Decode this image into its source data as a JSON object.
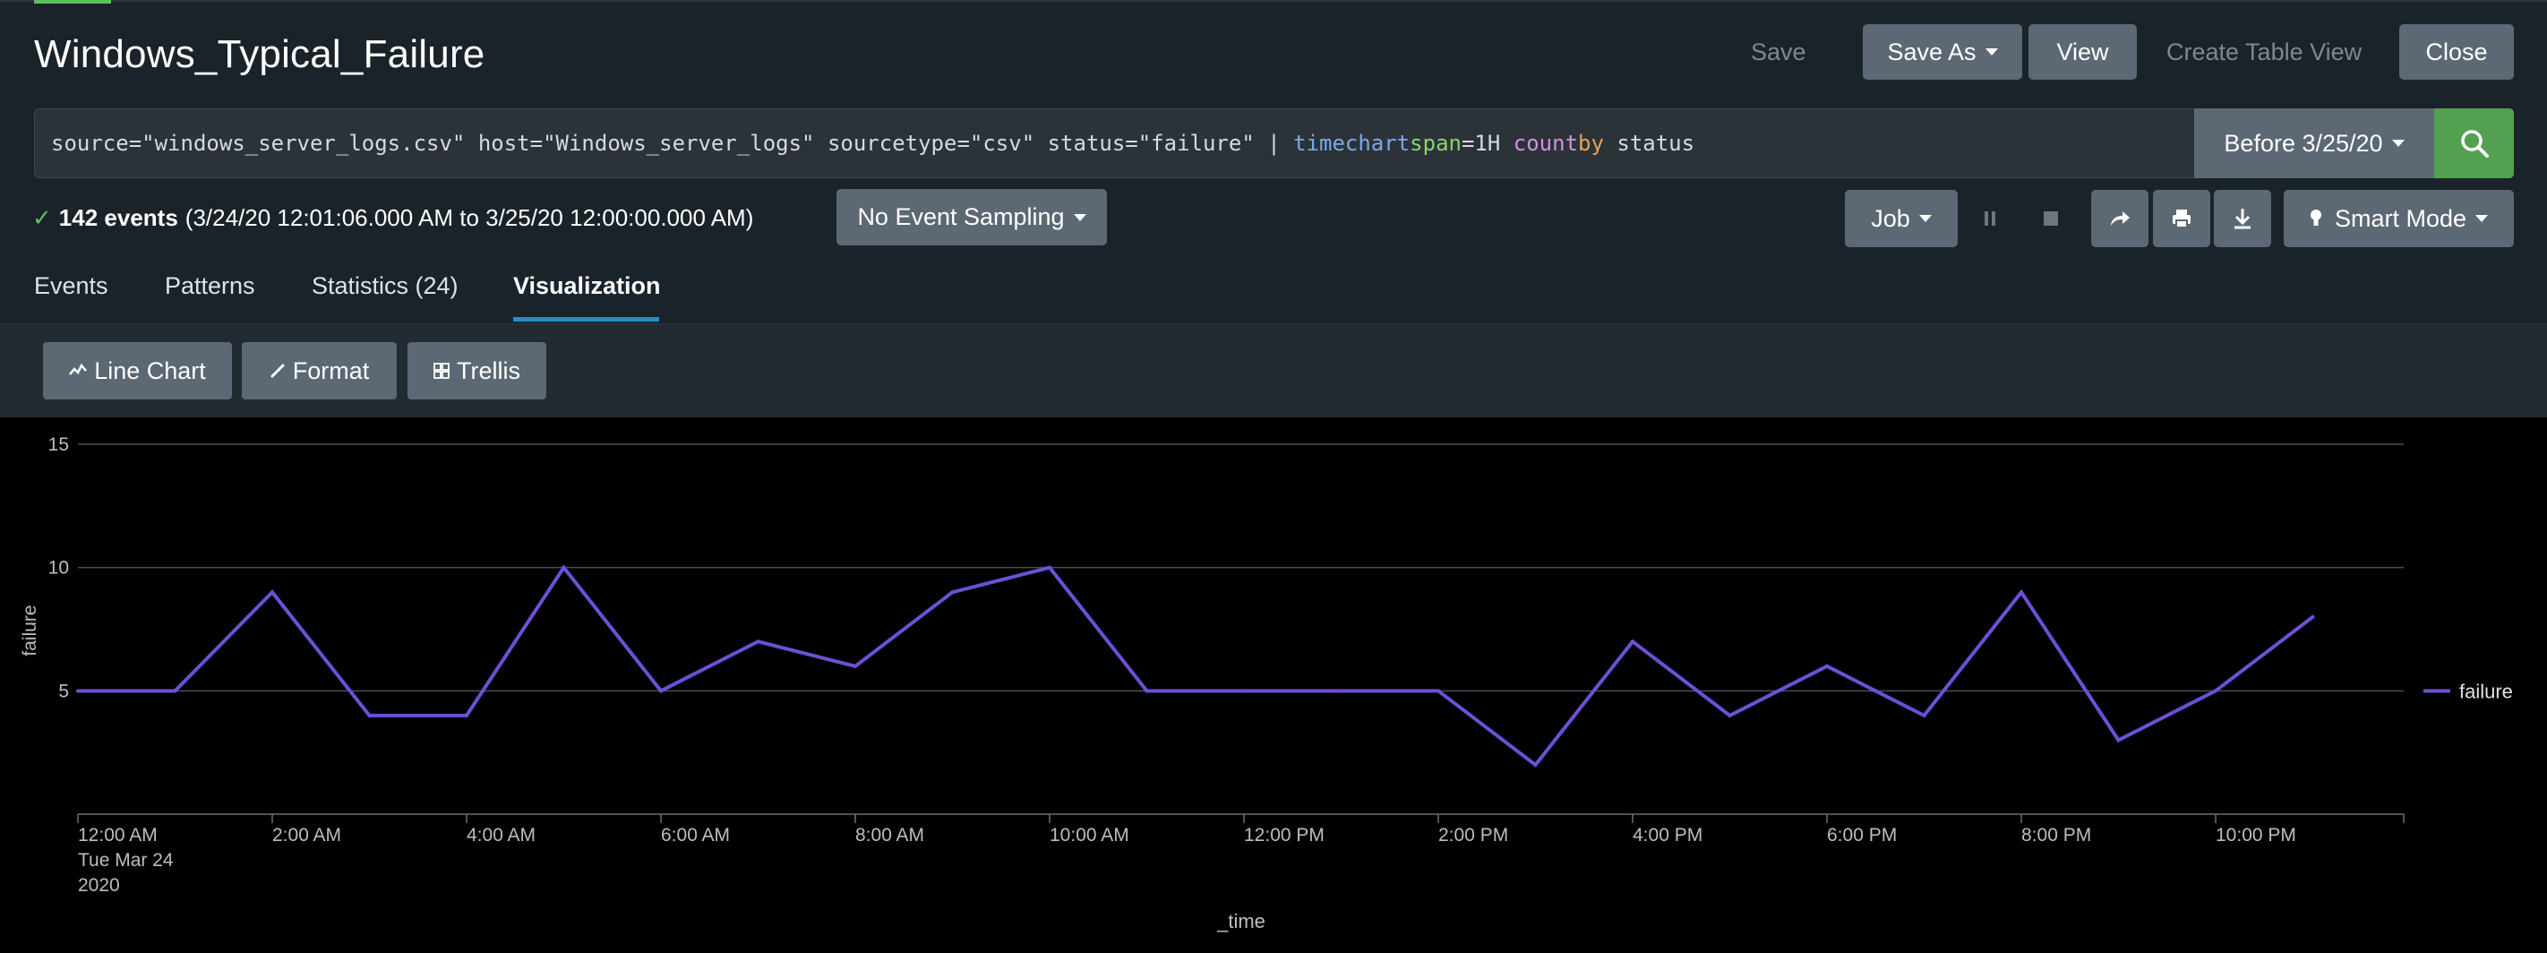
{
  "header": {
    "title": "Windows_Typical_Failure",
    "save_label": "Save",
    "save_as_label": "Save As",
    "view_label": "View",
    "create_table_view_label": "Create Table View",
    "close_label": "Close"
  },
  "search": {
    "query_parts": {
      "base": "source=\"windows_server_logs.csv\" host=\"Windows_server_logs\" sourcetype=\"csv\" status=\"failure\" | ",
      "cmd": "timechart",
      "arg_key": "span",
      "arg_val": "=1H ",
      "func": "count",
      "by": "by",
      "field": " status"
    },
    "time_range_label": "Before 3/25/20",
    "search_icon": "magnifier-icon"
  },
  "status": {
    "events_count": "142 events",
    "range": "(3/24/20 12:01:06.000 AM to 3/25/20 12:00:00.000 AM)",
    "sampling_label": "No Event Sampling",
    "job_label": "Job",
    "mode_label": "Smart Mode"
  },
  "tabs": [
    {
      "label": "Events"
    },
    {
      "label": "Patterns"
    },
    {
      "label": "Statistics (24)"
    },
    {
      "label": "Visualization"
    }
  ],
  "viz_toolbar": {
    "line_chart_label": "Line Chart",
    "format_label": "Format",
    "trellis_label": "Trellis"
  },
  "colors": {
    "series": "#6e4fd6",
    "accent_green": "#53a051",
    "button": "#5c6873",
    "tab_underline": "#1e93c6"
  },
  "chart_data": {
    "type": "line",
    "xlabel": "_time",
    "ylabel": "failure",
    "ylim": [
      0,
      15
    ],
    "yticks": [
      "5",
      "10",
      "15"
    ],
    "x": [
      "12:00 AM",
      "1:00 AM",
      "2:00 AM",
      "3:00 AM",
      "4:00 AM",
      "5:00 AM",
      "6:00 AM",
      "7:00 AM",
      "8:00 AM",
      "9:00 AM",
      "10:00 AM",
      "11:00 AM",
      "12:00 PM",
      "1:00 PM",
      "2:00 PM",
      "3:00 PM",
      "4:00 PM",
      "5:00 PM",
      "6:00 PM",
      "7:00 PM",
      "8:00 PM",
      "9:00 PM",
      "10:00 PM",
      "11:00 PM"
    ],
    "x_tick_labels": [
      "12:00 AM",
      "2:00 AM",
      "4:00 AM",
      "6:00 AM",
      "8:00 AM",
      "10:00 AM",
      "12:00 PM",
      "2:00 PM",
      "4:00 PM",
      "6:00 PM",
      "8:00 PM",
      "10:00 PM"
    ],
    "x_first_sublabels": [
      "Tue Mar 24",
      "2020"
    ],
    "series": [
      {
        "name": "failure",
        "values": [
          5,
          5,
          9,
          4,
          4,
          10,
          5,
          7,
          6,
          9,
          10,
          5,
          5,
          5,
          5,
          2,
          7,
          4,
          6,
          4,
          9,
          3,
          5,
          8
        ]
      }
    ],
    "legend": "right",
    "grid": true
  }
}
